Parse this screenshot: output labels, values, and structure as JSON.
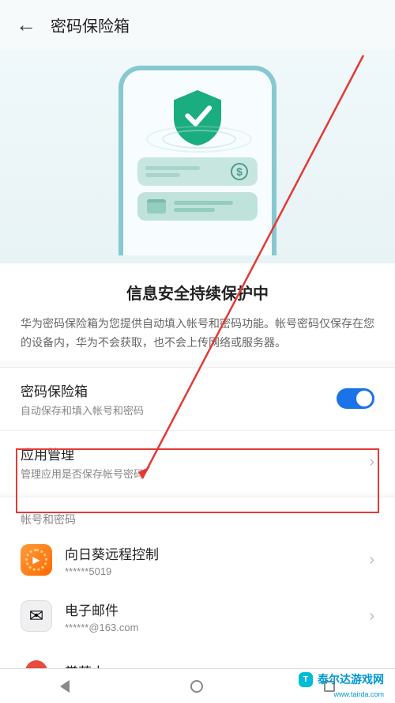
{
  "header": {
    "title": "密码保险箱"
  },
  "hero": {
    "shield_icon": "shield-check"
  },
  "info": {
    "title": "信息安全持续保护中",
    "description": "华为密码保险箱为您提供自动填入帐号和密码功能。帐号密码仅保存在您的设备内，华为不会获取，也不会上传网络或服务器。"
  },
  "settings": {
    "vault": {
      "title": "密码保险箱",
      "subtitle": "自动保存和填入帐号和密码",
      "enabled": true
    },
    "app_manage": {
      "title": "应用管理",
      "subtitle": "管理应用是否保存帐号密码"
    }
  },
  "accounts": {
    "section_label": "帐号和密码",
    "items": [
      {
        "name": "向日葵远程控制",
        "detail": "******5019"
      },
      {
        "name": "电子邮件",
        "detail": "******@163.com"
      },
      {
        "name": "掌萌人",
        "detail": ""
      }
    ]
  },
  "watermark": {
    "badge": "T",
    "site": "泰尔达游戏网",
    "url": "www.tairda.com"
  },
  "annotation": {
    "highlight_target": "app-manage-row"
  }
}
